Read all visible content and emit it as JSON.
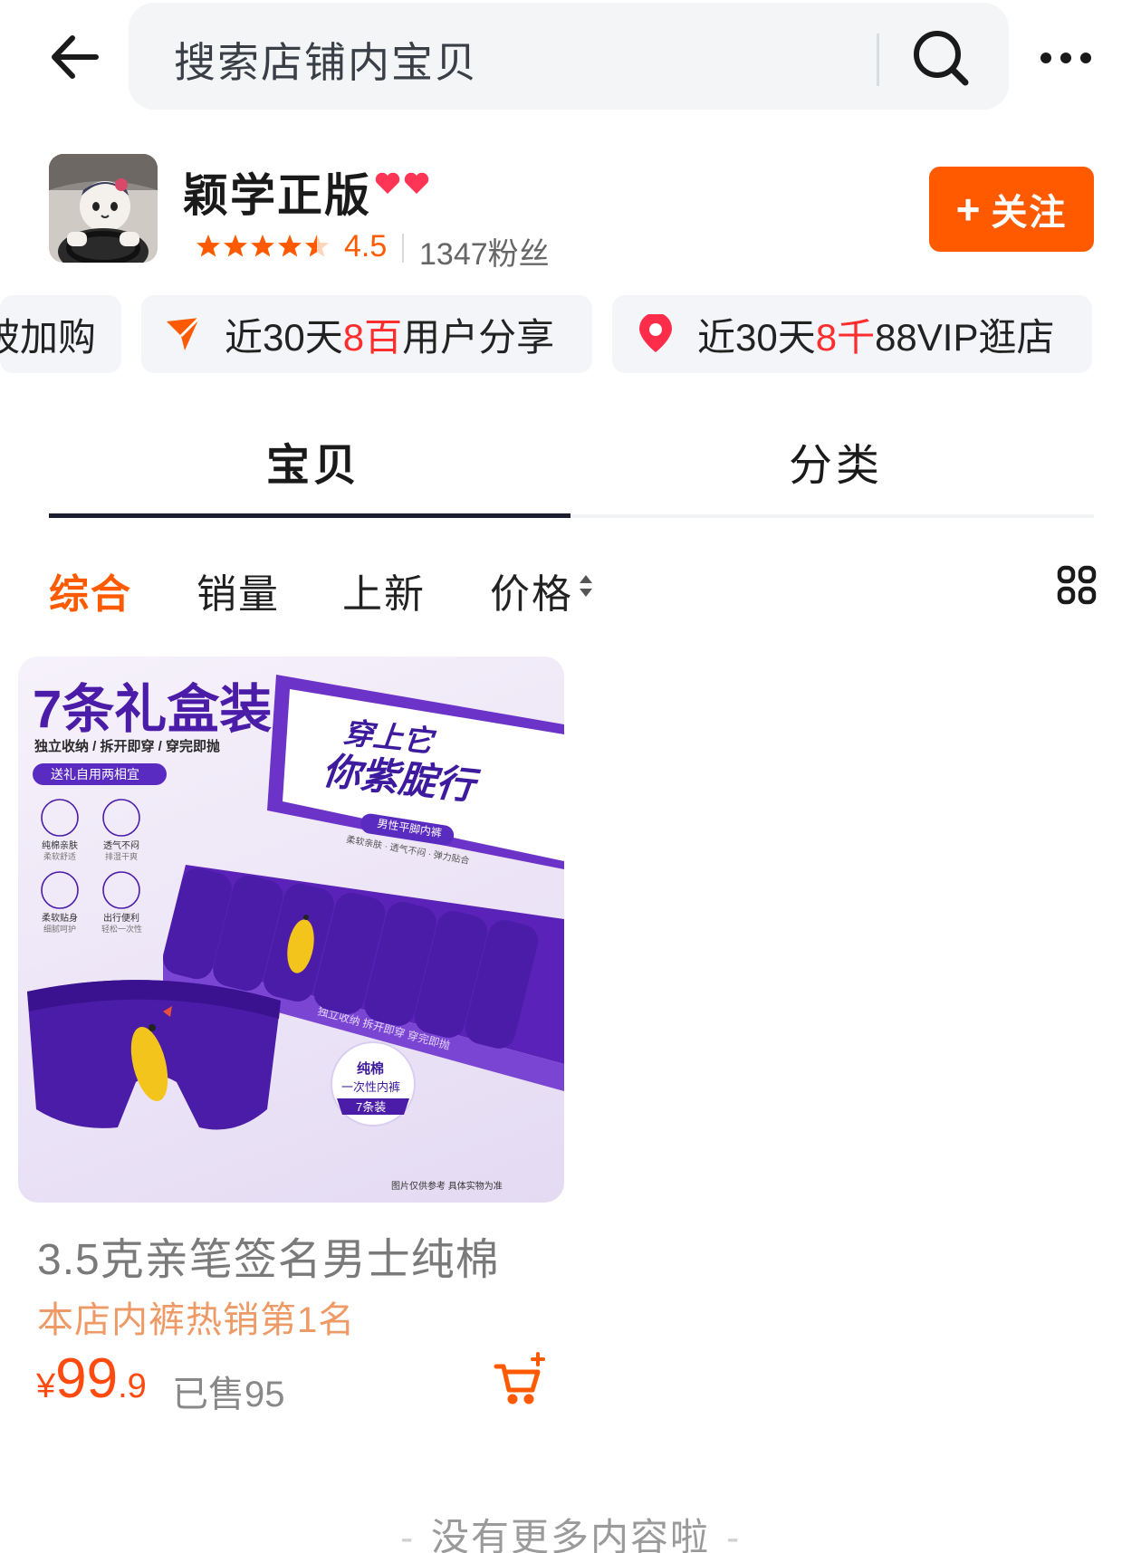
{
  "search": {
    "placeholder": "搜索店铺内宝贝"
  },
  "shop": {
    "name": "颖学正版",
    "rating": "4.5",
    "fans": "1347粉丝",
    "follow_label": "关注",
    "follow_plus": "+"
  },
  "chips": [
    {
      "text": "被加购",
      "icon": "cart-icon"
    },
    {
      "pre": "近30天",
      "hl": "8百",
      "post": "用户分享",
      "icon": "share-arrow-icon"
    },
    {
      "pre": "近30天",
      "hl": "8千",
      "post": "88VIP逛店",
      "icon": "heart-badge-icon"
    }
  ],
  "tabs": [
    {
      "label": "宝贝",
      "active": true
    },
    {
      "label": "分类",
      "active": false
    }
  ],
  "sort": [
    {
      "label": "综合",
      "active": true
    },
    {
      "label": "销量"
    },
    {
      "label": "上新"
    },
    {
      "label": "价格"
    }
  ],
  "product": {
    "image": {
      "headline": "7条礼盒装",
      "sub": "独立收纳 / 拆开即穿 / 穿完即抛",
      "badge": "送礼自用两相宜",
      "features": [
        {
          "t": "纯棉亲肤",
          "s": "柔软舒适"
        },
        {
          "t": "透气不闷",
          "s": "排湿干爽"
        },
        {
          "t": "柔软贴身",
          "s": "细腻呵护"
        },
        {
          "t": "出行便利",
          "s": "轻松一次性"
        }
      ],
      "lid_line1": "穿上它",
      "lid_line2": "你紫腚行",
      "lid_tag": "男性平脚内裤",
      "lid_small": "柔软亲肤 · 透气不闷 · 弹力贴合",
      "box_side": "独立收纳  拆开即穿  穿完即抛",
      "seal_line1": "纯棉",
      "seal_line2": "一次性内裤",
      "seal_ribbon": "7条装",
      "disclaimer": "图片仅供参考 具体实物为准"
    },
    "title": "3.5克亲笔签名男士纯棉",
    "rank": "本店内裤热销第1名",
    "price_currency": "¥",
    "price_int": "99",
    "price_dec": ".9",
    "sold": "已售95"
  },
  "footer": {
    "end_text": "没有更多内容啦",
    "dash": "-"
  },
  "colors": {
    "accent": "#ff5a00",
    "highlight": "#ff2d2d",
    "product_purple": "#4a1ca8",
    "rank_text": "#ee9a66"
  }
}
